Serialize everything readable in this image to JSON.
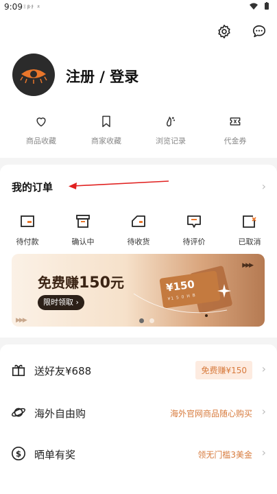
{
  "status": {
    "time": "9:09",
    "mini": "Ξ  β·扌  ㅊ"
  },
  "profile": {
    "login_label": "注册 / 登录"
  },
  "quick": [
    {
      "label": "商品收藏",
      "icon": "heart-icon"
    },
    {
      "label": "商家收藏",
      "icon": "bookmark-icon"
    },
    {
      "label": "浏览记录",
      "icon": "footprint-icon"
    },
    {
      "label": "代金券",
      "icon": "ticket-icon"
    }
  ],
  "orders": {
    "title": "我的订单",
    "items": [
      {
        "label": "待付款",
        "icon": "wallet-icon"
      },
      {
        "label": "确认中",
        "icon": "box-icon"
      },
      {
        "label": "待收货",
        "icon": "truck-icon"
      },
      {
        "label": "待评价",
        "icon": "comment-icon"
      },
      {
        "label": "已取消",
        "icon": "cancel-icon"
      }
    ]
  },
  "banner": {
    "headline_prefix": "免费赚",
    "headline_amount": "150",
    "headline_suffix": "元",
    "pill": "限时领取",
    "coupon": "¥150",
    "coupon_sub": "¥1 5 0 H B",
    "slide_count": 2,
    "active_slide": 1
  },
  "rows": [
    {
      "title": "送好友¥688",
      "right": "免费赚¥150",
      "icon": "gift-icon",
      "style": "tag"
    },
    {
      "title": "海外自由购",
      "right": "海外官网商品随心购买",
      "icon": "planet-icon",
      "style": "text"
    },
    {
      "title": "晒单有奖",
      "right": "领无门槛3美金",
      "icon": "dollar-icon",
      "style": "text"
    }
  ],
  "colors": {
    "accent": "#d77a3c",
    "annotation": "#e0201f",
    "avatar_bg": "#2b2b2b",
    "eye": "#e9762b"
  }
}
